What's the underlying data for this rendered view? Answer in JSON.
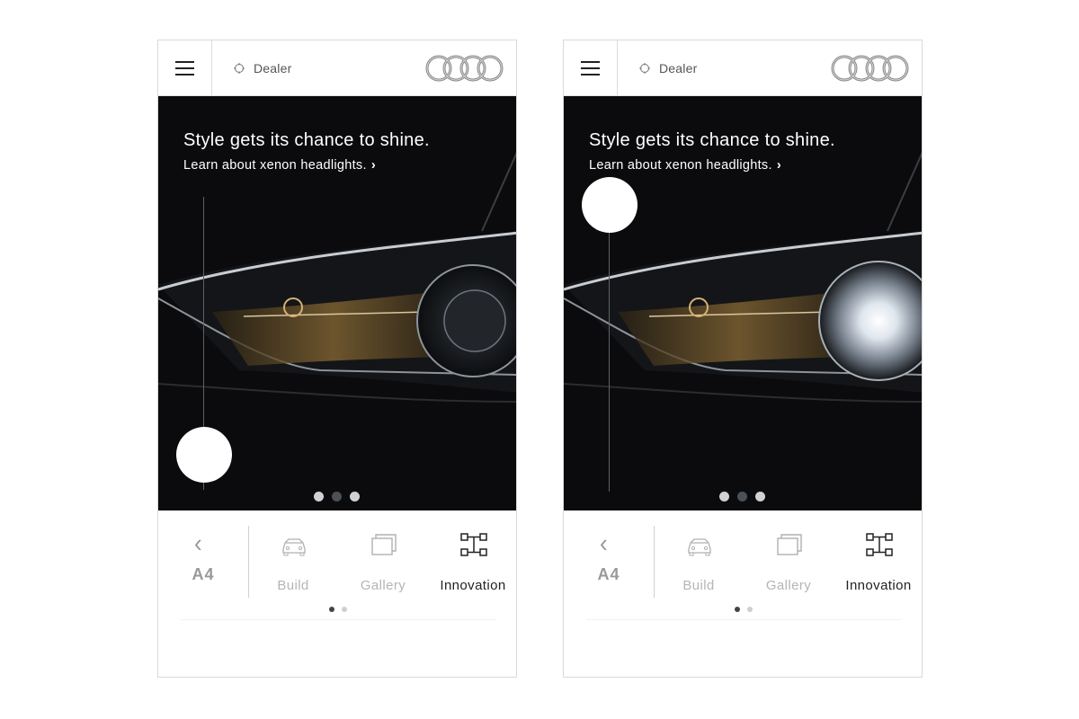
{
  "screens": [
    {
      "topbar": {
        "dealer_label": "Dealer"
      },
      "hero": {
        "title": "Style gets its chance to shine.",
        "link_text": "Learn about xenon headlights.",
        "link_chevron": "›",
        "slider_level": 0,
        "carousel_dots": 3,
        "active_dot": 1
      },
      "bottom_nav": {
        "back_chevron": "‹",
        "model": "A4",
        "items": [
          {
            "label": "Build",
            "icon": "car-icon"
          },
          {
            "label": "Gallery",
            "icon": "gallery-icon"
          },
          {
            "label": "Innovation",
            "icon": "innovation-icon",
            "active": true
          }
        ],
        "pager_dots": 2,
        "active_pager": 0
      }
    },
    {
      "topbar": {
        "dealer_label": "Dealer"
      },
      "hero": {
        "title": "Style gets its chance to shine.",
        "link_text": "Learn about xenon headlights.",
        "link_chevron": "›",
        "slider_level": 1,
        "carousel_dots": 3,
        "active_dot": 1
      },
      "bottom_nav": {
        "back_chevron": "‹",
        "model": "A4",
        "items": [
          {
            "label": "Build",
            "icon": "car-icon"
          },
          {
            "label": "Gallery",
            "icon": "gallery-icon"
          },
          {
            "label": "Innovation",
            "icon": "innovation-icon",
            "active": true
          }
        ],
        "pager_dots": 2,
        "active_pager": 0
      }
    }
  ],
  "colors": {
    "hero_bg": "#0b0b0d",
    "inactive_label": "#b5b5b5",
    "active_label": "#222222",
    "dot_active": "#4a5158",
    "dot_inactive": "#cfd2d4"
  }
}
